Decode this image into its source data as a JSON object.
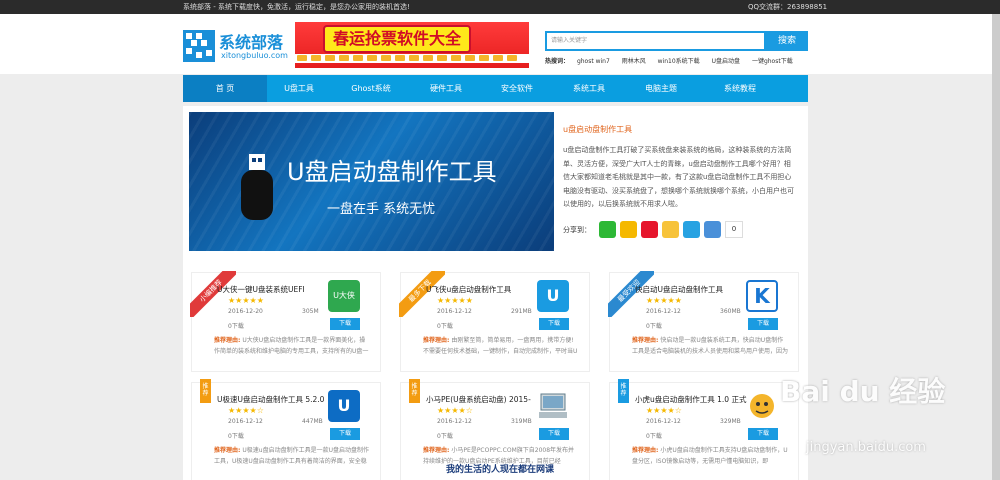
{
  "topbar": {
    "left": "系统部落 - 系统下载度快，免激活，运行稳定，是您办公家用的装机首选!",
    "right": "QQ交流群：263898851"
  },
  "logo": {
    "cn": "系统部落",
    "en": "xitongbuluo.com"
  },
  "banner": {
    "text": "春运抢票软件大全"
  },
  "search": {
    "placeholder": "请输入关键字",
    "button": "搜索"
  },
  "hot": {
    "label": "热搜词：",
    "items": [
      "ghost win7",
      "雨林木风",
      "win10系统下载",
      "U盘启动盘",
      "一键ghost下载"
    ]
  },
  "nav": [
    {
      "label": "首  页"
    },
    {
      "label": "U盘工具"
    },
    {
      "label": "Ghost系统"
    },
    {
      "label": "硬件工具"
    },
    {
      "label": "安全软件"
    },
    {
      "label": "系统工具"
    },
    {
      "label": "电脑主题"
    },
    {
      "label": "系统教程"
    }
  ],
  "featured": {
    "image_title": "U盘启动盘制作工具",
    "image_sub": "一盘在手  系统无忧",
    "title": "u盘启动盘制作工具",
    "desc": "u盘启动盘制作工具打破了买系统盘来装系统的格局，这种装系统的方法简单、灵活方便，深受广大IT人士的青睐，u盘启动盘制作工具哪个好用？相信大家都知道老毛桃就是其中一款，有了这款u盘启动盘制作工具不用担心电脑没有驱动、没买系统盘了，想换哪个系统就换哪个系统，小白用户也可以使用的，以后换系统就不用求人啦。",
    "share_label": "分享到：",
    "share_count": "0",
    "share_colors": [
      "#2db835",
      "#f5b800",
      "#e6162d",
      "#f7c33a",
      "#27a2e2",
      "#4a90d9"
    ]
  },
  "cards": [
    {
      "title": "U大侠一键U盘装系统UEFI",
      "stars": "★★★★★",
      "date": "2016-12-20",
      "size": "305M",
      "downloads": "0下载",
      "button": "下载",
      "badge": "小编推荐",
      "reason_label": "推荐理由:",
      "reason": "U大侠U盘启动盘制作工具是一款界面美化，操作简单的装系统和维护电脑的专用工具，支持所有的U盘一",
      "icon_text": "U大侠",
      "icon_color": "#2fa84f"
    },
    {
      "title": "U飞侠u盘启动盘制作工具",
      "stars": "★★★★★",
      "date": "2016-12-12",
      "size": "291MB",
      "downloads": "0下载",
      "button": "下载",
      "badge": "最多下载",
      "reason_label": "推荐理由:",
      "reason": "由刚繁至简，简单易用，一盘两用，携带方便!不需要任何技术基础，一键制作，自动完成制作，平时当U",
      "icon_text": "U",
      "icon_color": "#1a9be1"
    },
    {
      "title": "快启动U盘启动盘制作工具",
      "stars": "★★★★★",
      "date": "2016-12-12",
      "size": "360MB",
      "downloads": "0下载",
      "button": "下载",
      "badge": "最受欢迎",
      "reason_label": "推荐理由:",
      "reason": "快启动是一款U盘装系统工具，快启动U盘制作工具是适合电脑装机的技术人员使用和菜鸟用户使用，因为",
      "icon_text": "K",
      "icon_color": "#1976d2"
    },
    {
      "title": "U极速U盘启动盘制作工具 5.2.0",
      "stars": "★★★★☆",
      "date": "2016-12-12",
      "size": "447MB",
      "downloads": "0下载",
      "button": "下载",
      "badge": "推荐",
      "reason_label": "推荐理由:",
      "reason": "U极速u盘启动盘制作工具是一款U盘启动盘制作工具，U极速U盘启动盘制作工具有着简洁的界面，安全稳",
      "icon_text": "U",
      "icon_color": "#0d6cc4"
    },
    {
      "title": "小马PE(U盘系统启动盘) 2015-",
      "stars": "★★★★☆",
      "date": "2016-12-12",
      "size": "319MB",
      "downloads": "0下载",
      "button": "下载",
      "badge": "推荐",
      "reason_label": "推荐理由:",
      "reason": "小马PE是PCOPPC.COM旗下自2008年发布并持续维护的一款U盘启动PE系统维护工具，目前已经",
      "icon_text": "",
      "icon_color": "#7aa7c7"
    },
    {
      "title": "小虎u盘启动盘制作工具 1.0 正式",
      "stars": "★★★★☆",
      "date": "2016-12-12",
      "size": "329MB",
      "downloads": "0下载",
      "button": "下载",
      "badge": "推荐",
      "reason_label": "推荐理由:",
      "reason": "小虎U盘启动盘制作工具支持U盘启动盘制作，U盘分区，ISO镜像启动等，无需用户懂电脑知识，即",
      "icon_text": "",
      "icon_color": "#f4b52b"
    }
  ],
  "watermark": {
    "main": "Bai du 经验",
    "sub": "jingyan.baidu.com"
  },
  "caption": "我的生活的人现在都在网课"
}
